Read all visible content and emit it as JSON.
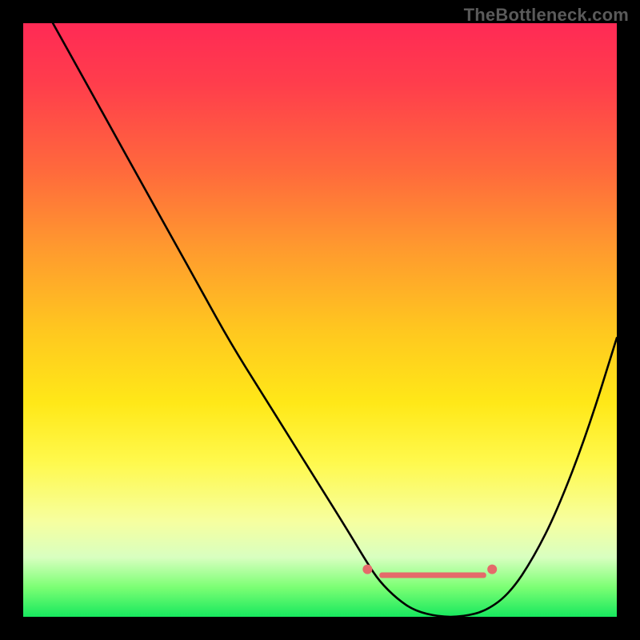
{
  "watermark": "TheBottleneck.com",
  "chart_data": {
    "type": "line",
    "title": "",
    "xlabel": "",
    "ylabel": "",
    "xlim": [
      0,
      100
    ],
    "ylim": [
      0,
      100
    ],
    "gradient_stops": [
      {
        "pos": 0,
        "color": "#ff2a55"
      },
      {
        "pos": 10,
        "color": "#ff3d4c"
      },
      {
        "pos": 25,
        "color": "#ff6a3c"
      },
      {
        "pos": 38,
        "color": "#ff9a2e"
      },
      {
        "pos": 52,
        "color": "#ffc81f"
      },
      {
        "pos": 64,
        "color": "#ffe818"
      },
      {
        "pos": 74,
        "color": "#fff94d"
      },
      {
        "pos": 84,
        "color": "#f6ffa0"
      },
      {
        "pos": 90,
        "color": "#d8ffc0"
      },
      {
        "pos": 95,
        "color": "#7cff74"
      },
      {
        "pos": 100,
        "color": "#17e85e"
      }
    ],
    "series": [
      {
        "name": "bottleneck-curve",
        "color": "#000000",
        "x": [
          5,
          10,
          15,
          20,
          25,
          30,
          35,
          40,
          45,
          50,
          55,
          58,
          60,
          63,
          66,
          70,
          74,
          78,
          82,
          86,
          90,
          95,
          100
        ],
        "y": [
          100,
          91,
          82,
          73,
          64,
          55,
          46,
          38,
          30,
          22,
          14,
          9,
          6,
          3,
          1,
          0,
          0,
          1,
          4,
          10,
          18,
          31,
          47
        ]
      }
    ],
    "markers": [
      {
        "name": "flat-region-left-dot",
        "x": 58,
        "y": 8,
        "color": "#e46a6a",
        "r": 6
      },
      {
        "name": "flat-region-right-dot",
        "x": 79,
        "y": 8,
        "color": "#e46a6a",
        "r": 6
      }
    ],
    "flat_region_band": {
      "x1": 60,
      "x2": 78,
      "y": 7,
      "color": "#e46a6a",
      "thickness": 7
    }
  }
}
